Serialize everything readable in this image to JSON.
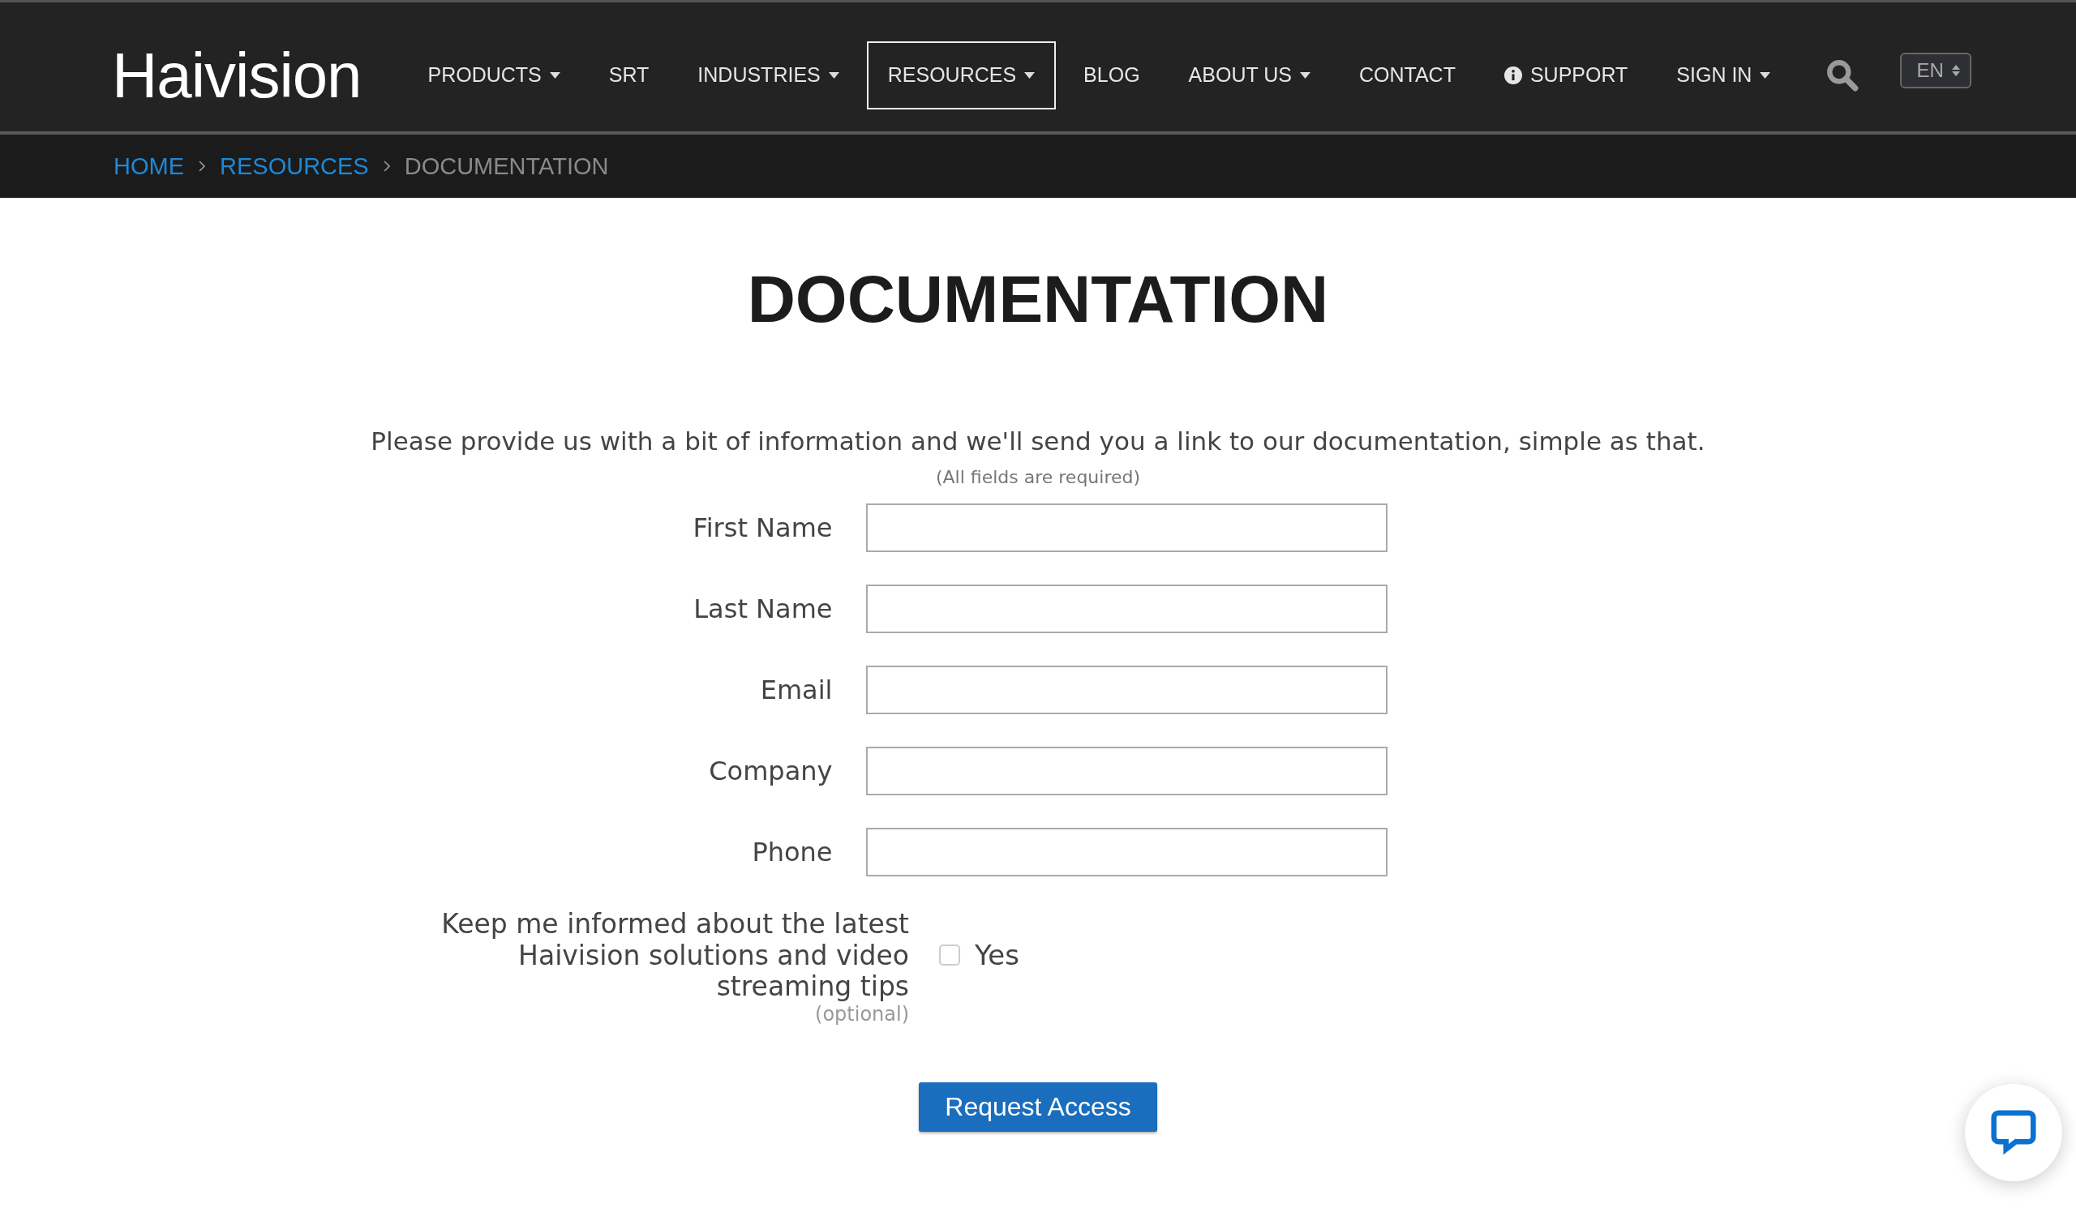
{
  "logo": "**Hai**vision",
  "nav": [
    {
      "label": "PRODUCTS",
      "kind": "dropdown",
      "selected": false
    },
    {
      "label": "SRT",
      "kind": "plain",
      "selected": false
    },
    {
      "label": "INDUSTRIES",
      "kind": "dropdown",
      "selected": false
    },
    {
      "label": "RESOURCES",
      "kind": "dropdown",
      "selected": true
    },
    {
      "label": "BLOG",
      "kind": "plain",
      "selected": false
    },
    {
      "label": "ABOUT US",
      "kind": "dropdown",
      "selected": false
    },
    {
      "label": "CONTACT",
      "kind": "plain",
      "selected": false
    },
    {
      "label": "SUPPORT",
      "kind": "info",
      "selected": false
    },
    {
      "label": "SIGN IN",
      "kind": "dropdown",
      "selected": false
    }
  ],
  "language": "EN",
  "breadcrumb": [
    {
      "label": "HOME",
      "kind": "link"
    },
    {
      "label": "RESOURCES",
      "kind": "link"
    },
    {
      "label": "DOCUMENTATION",
      "kind": "current"
    }
  ],
  "title": "DOCUMENTATION",
  "intro": "Please provide us with a bit of information and we'll send you a link to our documentation, simple as that.",
  "required_note": "(All fields are required)",
  "fields": [
    {
      "label": "First Name"
    },
    {
      "label": "Last Name"
    },
    {
      "label": "Email"
    },
    {
      "label": "Company"
    },
    {
      "label": "Phone"
    }
  ],
  "newsletter": {
    "label": "Keep me informed about the latest Haivision solutions and video streaming tips",
    "optional_note": "(optional)",
    "option_label": "Yes",
    "checked": false
  },
  "submit": "Request Access"
}
